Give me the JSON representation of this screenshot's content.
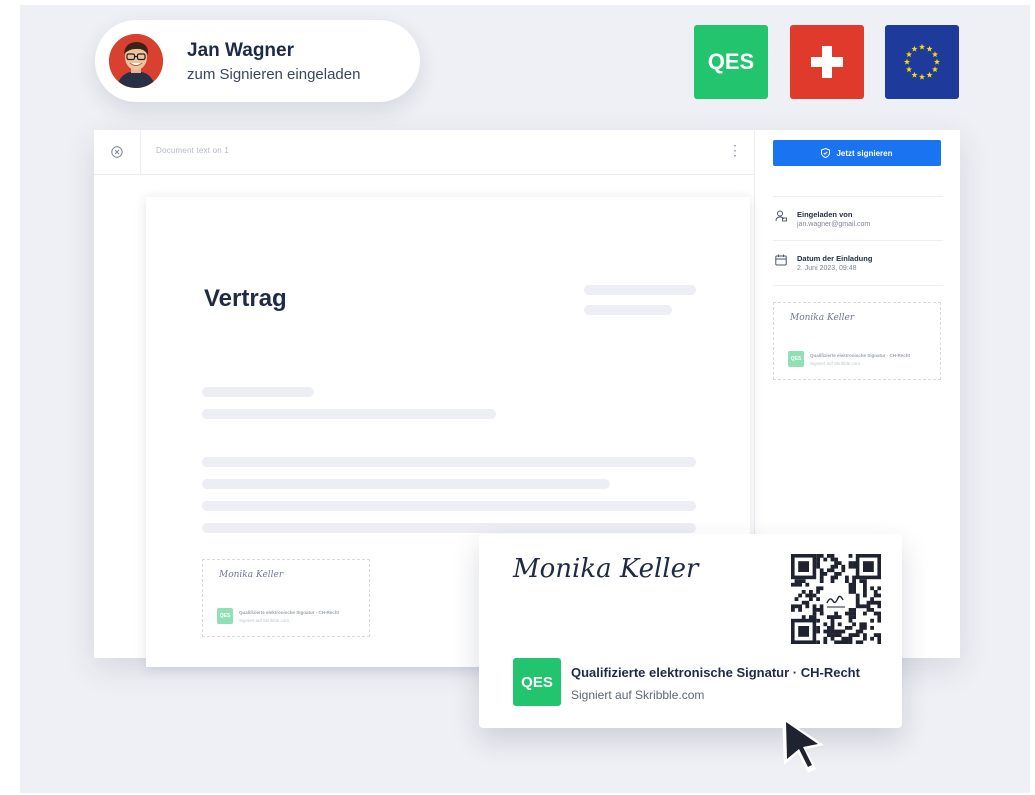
{
  "invitee": {
    "name": "Jan Wagner",
    "subtitle": "zum Signieren eingeladen"
  },
  "badges": {
    "qes": "QES",
    "ch_icon": "swiss-flag-icon",
    "eu_icon": "eu-flag-icon"
  },
  "topbar": {
    "document_name": "Document text on 1",
    "menu_icon": "kebab-icon"
  },
  "sidebar": {
    "sign_button": "Jetzt signieren",
    "invited_by_label": "Eingeladen von",
    "invited_by_value": "jan.wagner@gmail.com",
    "date_label": "Datum der Einladung",
    "date_value": "2. Juni 2023, 09:48",
    "signature_name": "Monika Keller",
    "signature_qes": "QES",
    "signature_line1": "Qualifizierte elektronische Signatur · CH-Recht",
    "signature_line2": "Signiert auf Skribble.com"
  },
  "document": {
    "title": "Vertrag",
    "signature_name": "Monika Keller",
    "signature_qes": "QES",
    "signature_line1": "Qualifizierte elektronische Signatur · CH-Recht",
    "signature_line2": "Signiert auf Skribble.com"
  },
  "signature_card": {
    "name": "Monika Keller",
    "qes": "QES",
    "line1": "Qualifizierte elektronische Signatur · CH-Recht",
    "line2": "Signiert auf Skribble.com"
  },
  "colors": {
    "qes_green": "#23c46e",
    "swiss_red": "#e03a2c",
    "eu_blue": "#1e3a9b",
    "primary_blue": "#1a73f0"
  }
}
